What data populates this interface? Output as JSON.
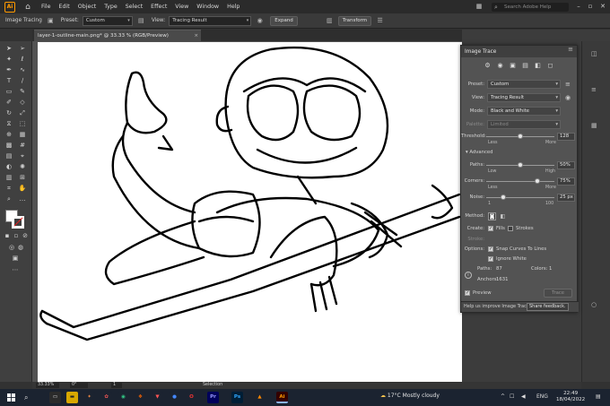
{
  "menubar": {
    "logo": "Ai",
    "items": [
      "File",
      "Edit",
      "Object",
      "Type",
      "Select",
      "Effect",
      "View",
      "Window",
      "Help"
    ],
    "search_placeholder": "Search Adobe Help"
  },
  "controlbar": {
    "context_label": "Image Tracing",
    "preset_label": "Preset:",
    "preset_value": "Custom",
    "view_label": "View:",
    "view_value": "Tracing Result",
    "expand_button": "Expand",
    "transform_button": "Transform"
  },
  "document": {
    "tab_title": "layer-1-outline-main.png* @ 33.33 % (RGB/Preview)"
  },
  "image_trace": {
    "title": "Image Trace",
    "preset_label": "Preset:",
    "preset_value": "Custom",
    "view_label": "View:",
    "view_value": "Tracing Result",
    "mode_label": "Mode:",
    "mode_value": "Black and White",
    "palette_label": "Palette:",
    "palette_value": "Limited",
    "threshold_label": "Threshold:",
    "threshold_value": "128",
    "threshold_min": "Less",
    "threshold_max": "More",
    "threshold_level": 0.5,
    "advanced_label": "Advanced",
    "paths_label": "Paths:",
    "paths_value": "50%",
    "paths_min": "Low",
    "paths_max": "High",
    "paths_level": 0.5,
    "corners_label": "Corners:",
    "corners_value": "75%",
    "corners_min": "Less",
    "corners_max": "More",
    "corners_level": 0.75,
    "noise_label": "Noise:",
    "noise_value": "25 px",
    "noise_min": "1",
    "noise_max": "100",
    "noise_level": 0.25,
    "method_label": "Method:",
    "create_label": "Create:",
    "fills_label": "Fills",
    "fills_checked": true,
    "strokes_label": "Strokes",
    "strokes_checked": false,
    "stroke_label": "Stroke:",
    "options_label": "Options:",
    "snap_label": "Snap Curves To Lines",
    "snap_checked": true,
    "ignore_white_label": "Ignore White",
    "ignore_white_checked": true,
    "paths_stat_label": "Paths:",
    "paths_stat_value": "87",
    "colors_stat_label": "Colors:",
    "colors_stat_value": "1",
    "anchors_stat_label": "Anchors:",
    "anchors_stat_value": "1631",
    "preview_label": "Preview",
    "preview_checked": true,
    "trace_button": "Trace",
    "footer_text": "Help us improve Image Trace",
    "feedback_button": "Share feedback."
  },
  "statusbar": {
    "zoom": "33.33%",
    "rotation": "0°",
    "artboard": "1",
    "tool": "Selection"
  },
  "taskbar": {
    "weather": "17°C  Mostly cloudy",
    "language": "ENG",
    "time": "22:49",
    "date": "18/04/2022",
    "apps": [
      "Ai",
      "Ps",
      "Pr"
    ]
  },
  "colors": {
    "accent_orange": "#ff9a00",
    "panel_bg": "#535353",
    "taskbar_bg": "#1b2330"
  }
}
